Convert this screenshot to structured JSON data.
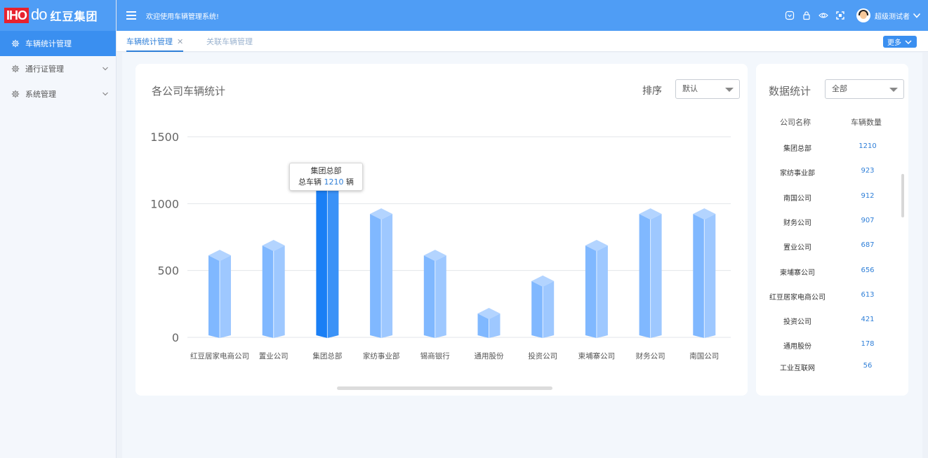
{
  "logo": {
    "part1": "IHO",
    "part2": "do",
    "cn": "红豆集团"
  },
  "sidebar": {
    "items": [
      {
        "label": "车辆统计管理",
        "active": true,
        "expandable": false
      },
      {
        "label": "通行证管理",
        "active": false,
        "expandable": true
      },
      {
        "label": "系统管理",
        "active": false,
        "expandable": true
      }
    ]
  },
  "header": {
    "welcome": "欢迎使用车辆管理系统!",
    "username": "超级测试者"
  },
  "tabs": {
    "items": [
      {
        "label": "车辆统计管理",
        "active": true,
        "closable": true
      },
      {
        "label": "关联车辆管理",
        "active": false,
        "closable": false
      }
    ],
    "more_label": "更多"
  },
  "chart_panel": {
    "title": "各公司车辆统计",
    "sort_label": "排序",
    "sort_value": "默认",
    "tooltip": {
      "title": "集团总部",
      "prefix": "总车辆",
      "value": "1210",
      "suffix": "辆"
    }
  },
  "chart_data": {
    "type": "bar",
    "categories": [
      "红豆居家电商公司",
      "置业公司",
      "集团总部",
      "家纺事业部",
      "锡商银行",
      "通用股份",
      "投资公司",
      "柬埔寨公司",
      "财务公司",
      "南国公司"
    ],
    "values": [
      613,
      687,
      1210,
      923,
      613,
      178,
      421,
      687,
      923,
      923
    ],
    "highlight_index": 2,
    "yticks": [
      0,
      500,
      1000,
      1500
    ],
    "ylim": [
      0,
      1500
    ],
    "grid": true,
    "colors": {
      "bar": "#80b8ff",
      "bar_side": "#9ec8ff",
      "bar_top": "#b3d4ff",
      "highlight": "#1a7ff5",
      "highlight_side": "#3a92f7",
      "highlight_top": "#6aaefa"
    }
  },
  "stat_panel": {
    "title": "数据统计",
    "filter_value": "全部",
    "col_name": "公司名称",
    "col_count": "车辆数量",
    "rows": [
      {
        "name": "集团总部",
        "count": "1210"
      },
      {
        "name": "家纺事业部",
        "count": "923"
      },
      {
        "name": "南国公司",
        "count": "912"
      },
      {
        "name": "财务公司",
        "count": "907"
      },
      {
        "name": "置业公司",
        "count": "687"
      },
      {
        "name": "柬埔寨公司",
        "count": "656"
      },
      {
        "name": "红豆居家电商公司",
        "count": "613"
      },
      {
        "name": "投资公司",
        "count": "421"
      },
      {
        "name": "通用股份",
        "count": "178"
      },
      {
        "name": "工业互联网",
        "count": "56"
      }
    ]
  }
}
